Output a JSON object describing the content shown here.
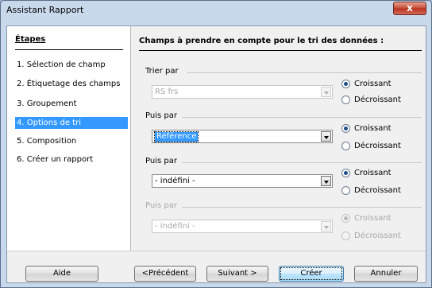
{
  "window": {
    "title": "Assistant Rapport",
    "close_label": "x"
  },
  "sidebar": {
    "heading": "Étapes",
    "steps": [
      {
        "label": "1.  Sélection de champ"
      },
      {
        "label": "2.  Étiquetage des champs"
      },
      {
        "label": "3.  Groupement"
      },
      {
        "label": "4.  Options de tri"
      },
      {
        "label": "5.  Composition"
      },
      {
        "label": "6.  Créer un rapport"
      }
    ]
  },
  "main": {
    "heading": "Champs à prendre en compte pour le tri des données :",
    "groups": [
      {
        "label": "Trier par",
        "value": "RS frs",
        "asc": "Croissant",
        "desc": "Décroissant"
      },
      {
        "label": "Puis par",
        "value": "Référence",
        "asc": "Croissant",
        "desc": "Décroissant"
      },
      {
        "label": "Puis par",
        "value": "- indéfini -",
        "asc": "Croissant",
        "desc": "Décroissant"
      },
      {
        "label": "Puis par",
        "value": "- indéfini -",
        "asc": "Croissant",
        "desc": "Décroissant"
      }
    ]
  },
  "buttons": {
    "help": "Aide",
    "prev": "<Précédent",
    "next": "Suivant >",
    "create": "Créer",
    "cancel": "Annuler"
  }
}
